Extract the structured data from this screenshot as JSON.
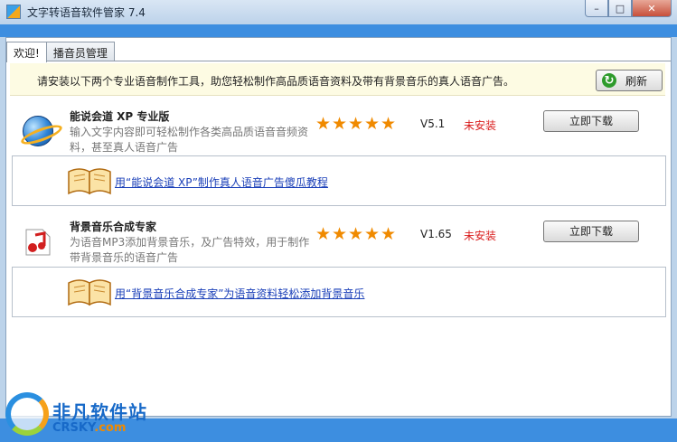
{
  "window": {
    "title": "文字转语音软件管家 7.4",
    "minimize_glyph": "–",
    "maximize_glyph": "□",
    "close_glyph": "✕"
  },
  "tabs": [
    {
      "label": "欢迎!",
      "active": true
    },
    {
      "label": "播音员管理",
      "active": false
    }
  ],
  "notice": {
    "text": "请安装以下两个专业语音制作工具，助您轻松制作高品质语音资料及带有背景音乐的真人语音广告。",
    "refresh_label": "刷新",
    "refresh_icon": "refresh-icon"
  },
  "products": [
    {
      "name": "能说会道 XP 专业版",
      "desc": "输入文字内容即可轻松制作各类高品质语音音频资料，甚至真人语音广告",
      "rating": 5,
      "version": "V5.1",
      "status": "未安装",
      "download_label": "立即下载",
      "icon": "globe-icon",
      "guide_link": "用“能说会道 XP”制作真人语音广告傻瓜教程"
    },
    {
      "name": "背景音乐合成专家",
      "desc": "为语音MP3添加背景音乐，及广告特效，用于制作带背景音乐的语音广告",
      "rating": 5,
      "version": "V1.65",
      "status": "未安装",
      "download_label": "立即下载",
      "icon": "music-note-icon",
      "guide_link": "用“背景音乐合成专家”为语音资料轻松添加背景音乐"
    }
  ],
  "watermark": {
    "title": "非凡软件站",
    "sub_main": "CRSKY",
    "sub_tail": ".com"
  },
  "colors": {
    "accent_blue": "#3d8ee0",
    "star": "#f08a00",
    "status_red": "#d91c1c",
    "link": "#1a3fb8"
  }
}
